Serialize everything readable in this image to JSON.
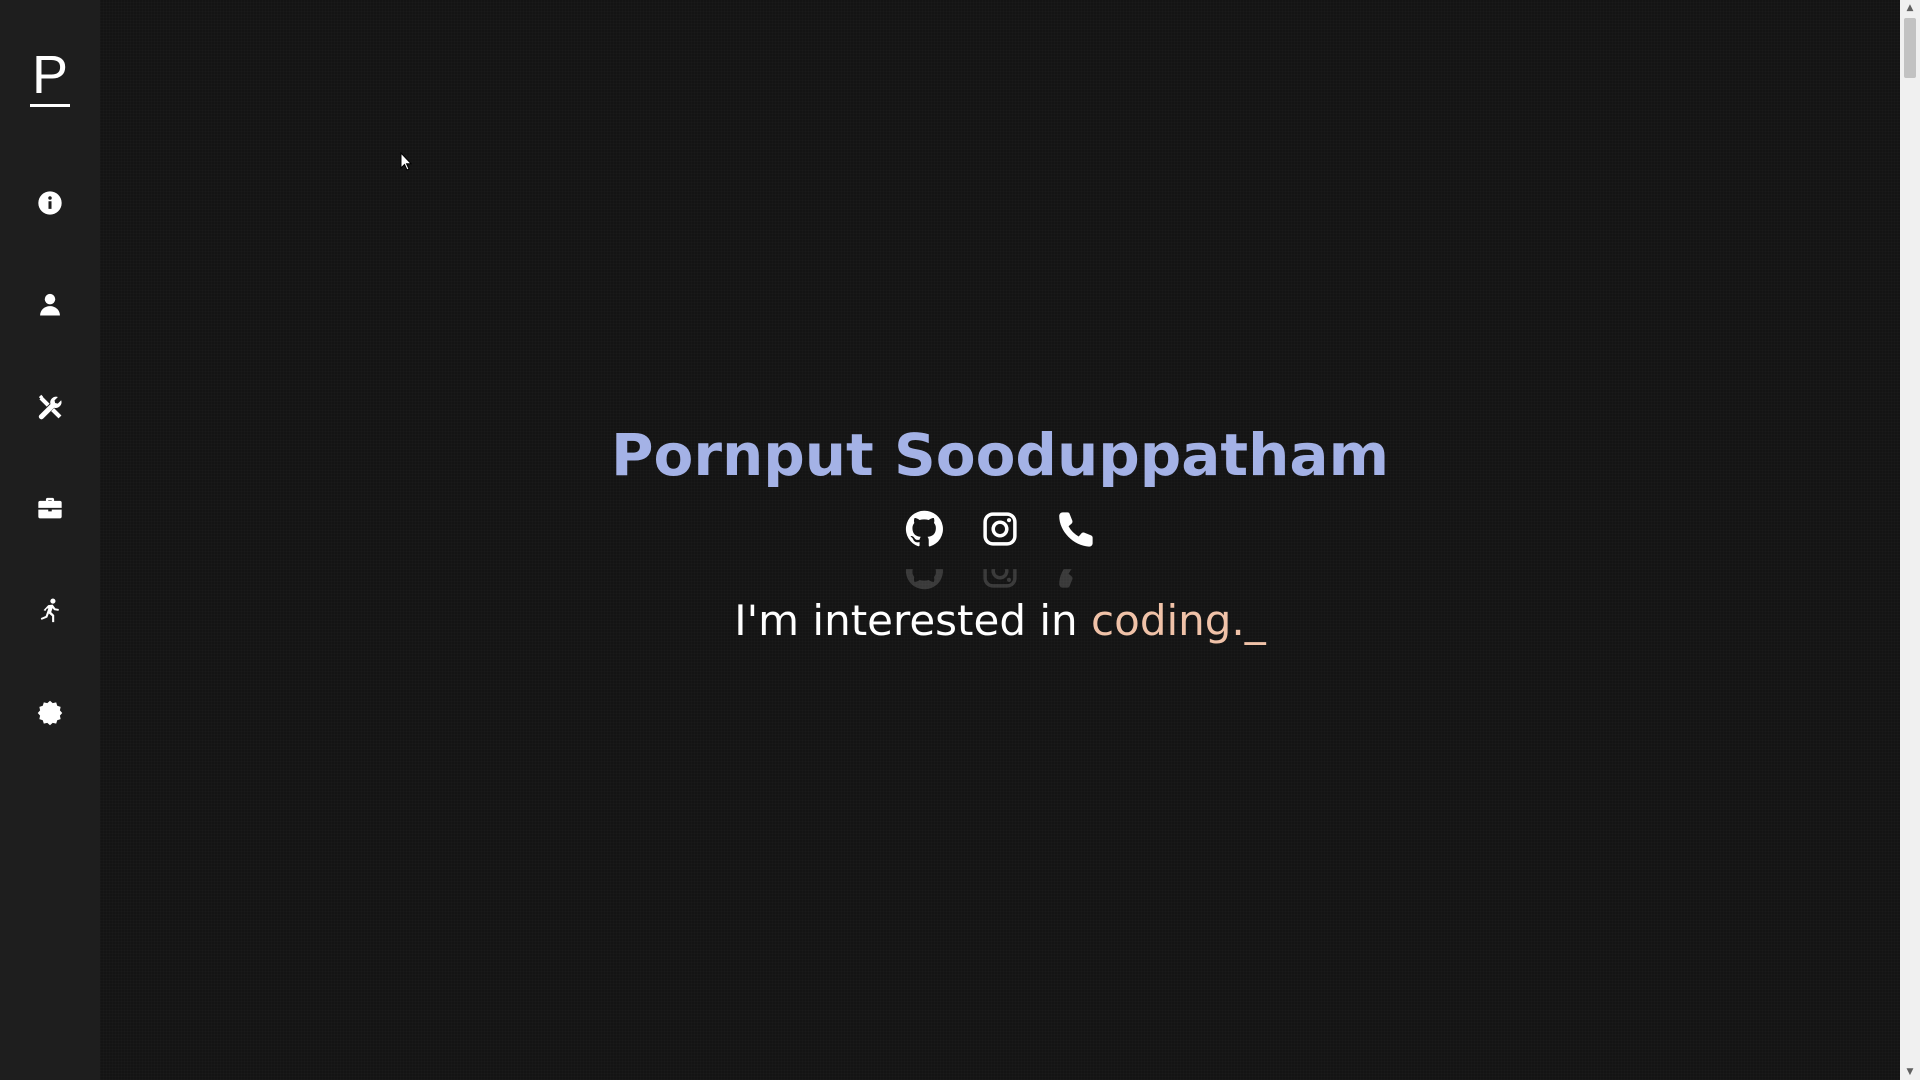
{
  "sidebar": {
    "logo": "P",
    "items": [
      {
        "icon": "info-icon",
        "label": "about"
      },
      {
        "icon": "user-icon",
        "label": "profile"
      },
      {
        "icon": "tools-icon",
        "label": "skills"
      },
      {
        "icon": "briefcase-icon",
        "label": "work"
      },
      {
        "icon": "running-icon",
        "label": "activities"
      },
      {
        "icon": "certificate-icon",
        "label": "awards"
      }
    ]
  },
  "hero": {
    "name": "Pornput Sooduppatham",
    "tagline_prefix": "I'm interested in ",
    "tagline_word": "coding.",
    "tagline_cursor": "_",
    "socials": [
      {
        "icon": "github-icon"
      },
      {
        "icon": "instagram-icon"
      },
      {
        "icon": "phone-icon"
      }
    ]
  },
  "colors": {
    "name": "#a4b2e6",
    "accent_word": "#f0c2a8",
    "background": "#141414",
    "sidebar": "#1e1e1e"
  }
}
